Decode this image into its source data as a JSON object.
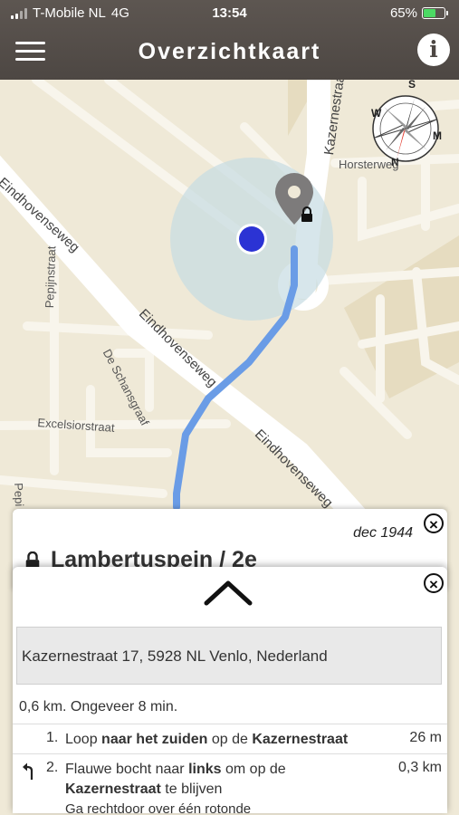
{
  "status": {
    "carrier": "T-Mobile NL",
    "network": "4G",
    "time": "13:54",
    "battery": "65%",
    "battery_fraction": 0.65
  },
  "header": {
    "title": "Overzichtkaart",
    "menu_icon": "hamburger-menu-icon",
    "info_icon": "i"
  },
  "map": {
    "streets": [
      "Kazernestraat",
      "Horsterweg",
      "Eindhovenseweg",
      "Eindhovenseweg",
      "Eindhovenseweg",
      "Pepijnstraat",
      "De Schansgraaf",
      "Excelsiorstraat",
      "Pepi"
    ],
    "compass_letters": {
      "n": "N",
      "s": "S",
      "e": "M",
      "w": "W"
    },
    "colors": {
      "land": "#efe9d7",
      "road": "#ffffff",
      "route": "#6a9ce6",
      "user": "#2b33d4",
      "accuracy": "#c6dbe3"
    }
  },
  "card_top": {
    "date": "dec 1944",
    "location": "Lambertuspein / 2e",
    "close": "×"
  },
  "card_route": {
    "close": "×",
    "address": "Kazernestraat 17, 5928 NL Venlo, Nederland",
    "summary": "0,6 km. Ongeveer 8 min.",
    "steps": [
      {
        "num": "1.",
        "pre": "Loop ",
        "bold1": "naar het zuiden",
        "mid": " op de ",
        "bold2": "Kazernestraat",
        "post": "",
        "distance": "26 m"
      },
      {
        "num": "2.",
        "pre": "Flauwe bocht naar ",
        "bold1": "links",
        "mid": " om op de ",
        "bold2": "Kazernestraat",
        "post": " te blijven",
        "extra": "Ga rechtdoor over één rotonde",
        "distance": "0,3 km"
      }
    ]
  }
}
